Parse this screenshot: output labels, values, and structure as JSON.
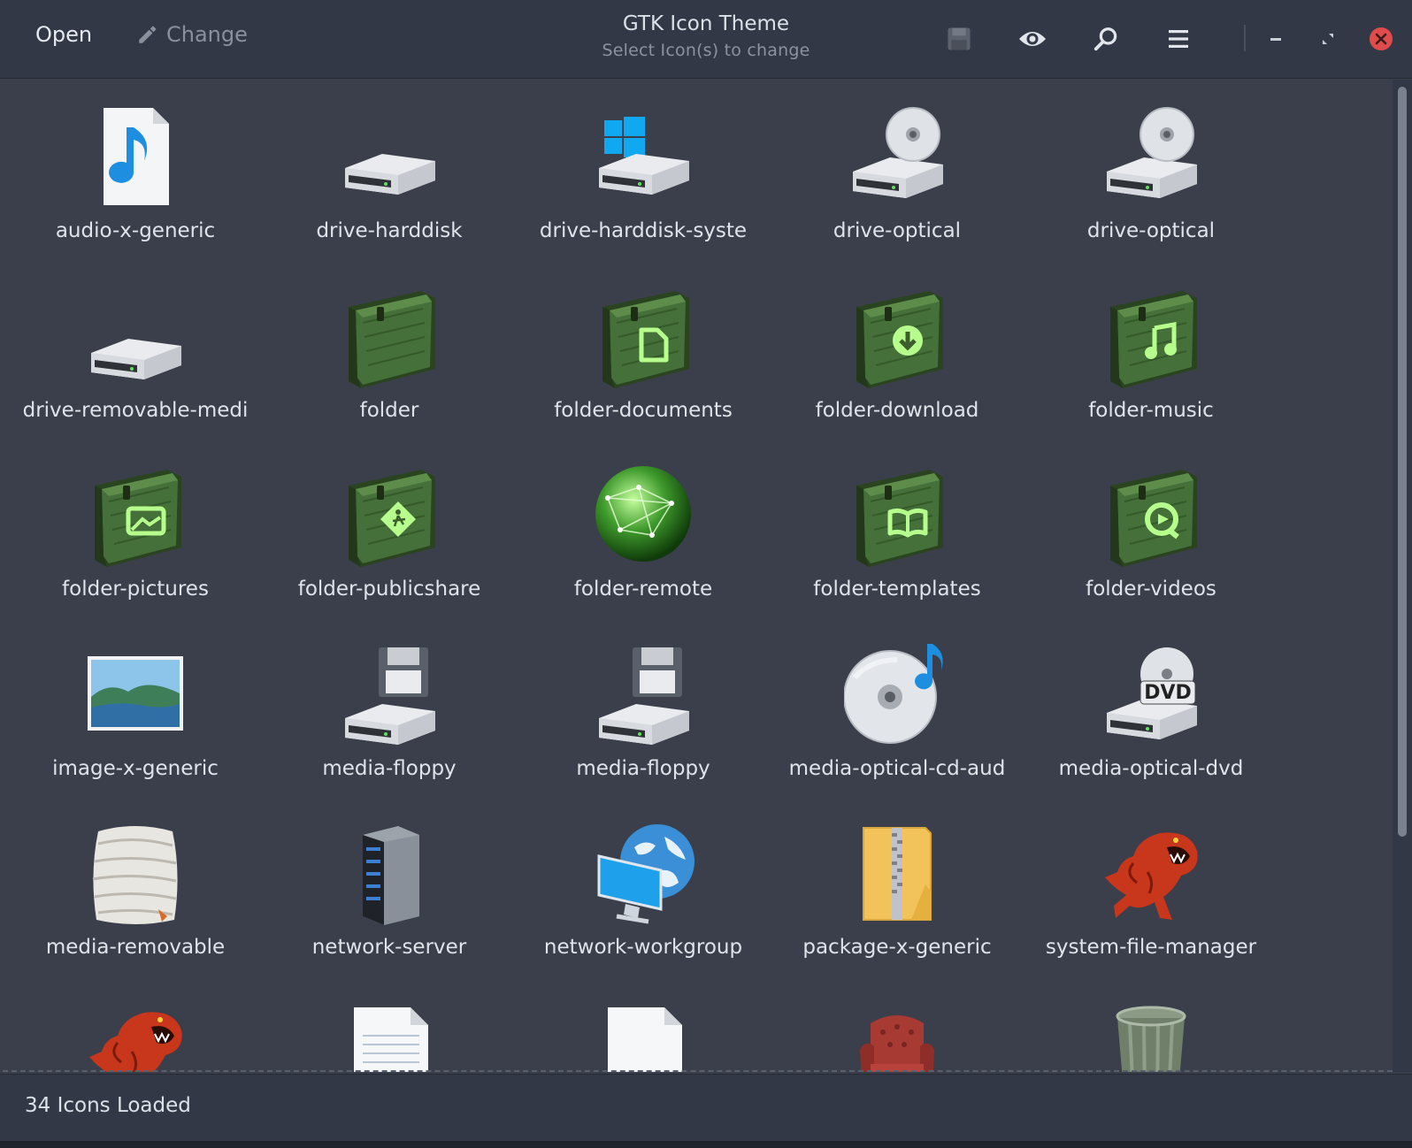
{
  "header": {
    "open_label": "Open",
    "change_label": "Change",
    "title": "GTK Icon Theme",
    "subtitle": "Select Icon(s) to change",
    "toolbar_icons": [
      "save-icon",
      "eye-icon",
      "search-icon",
      "menu-icon",
      "minimize-icon",
      "restore-icon",
      "close-icon"
    ]
  },
  "icons": [
    {
      "label": "audio-x-generic",
      "icon": "audio-file"
    },
    {
      "label": "drive-harddisk",
      "icon": "harddisk"
    },
    {
      "label": "drive-harddisk-syste",
      "icon": "harddisk-system"
    },
    {
      "label": "drive-optical",
      "icon": "optical-drive"
    },
    {
      "label": "drive-optical",
      "icon": "optical-drive"
    },
    {
      "label": "drive-removable-medi",
      "icon": "harddisk-small"
    },
    {
      "label": "folder",
      "icon": "folder"
    },
    {
      "label": "folder-documents",
      "icon": "folder-documents"
    },
    {
      "label": "folder-download",
      "icon": "folder-download"
    },
    {
      "label": "folder-music",
      "icon": "folder-music"
    },
    {
      "label": "folder-pictures",
      "icon": "folder-pictures"
    },
    {
      "label": "folder-publicshare",
      "icon": "folder-publicshare"
    },
    {
      "label": "folder-remote",
      "icon": "globe-green"
    },
    {
      "label": "folder-templates",
      "icon": "folder-templates"
    },
    {
      "label": "folder-videos",
      "icon": "folder-videos"
    },
    {
      "label": "image-x-generic",
      "icon": "landscape-image"
    },
    {
      "label": "media-floppy",
      "icon": "floppy-drive"
    },
    {
      "label": "media-floppy",
      "icon": "floppy-drive"
    },
    {
      "label": "media-optical-cd-aud",
      "icon": "cd-audio"
    },
    {
      "label": "media-optical-dvd",
      "icon": "dvd-drive"
    },
    {
      "label": "media-removable",
      "icon": "mummy"
    },
    {
      "label": "network-server",
      "icon": "server-tower"
    },
    {
      "label": "network-workgroup",
      "icon": "globe-monitor"
    },
    {
      "label": "package-x-generic",
      "icon": "zip-folder"
    },
    {
      "label": "system-file-manager",
      "icon": "red-creature"
    },
    {
      "label": "",
      "icon": "red-creature"
    },
    {
      "label": "",
      "icon": "text-document"
    },
    {
      "label": "",
      "icon": "blank-document"
    },
    {
      "label": "",
      "icon": "red-armchair"
    },
    {
      "label": "",
      "icon": "trash-can"
    }
  ],
  "status": {
    "text": "34 Icons Loaded"
  },
  "colors": {
    "background": "#3a3f4b",
    "header": "#323845",
    "folder_green": "#3d5e2c",
    "glow_green": "#a6f07a",
    "accent_blue": "#1e8fe0",
    "close_red": "#e04b4b"
  }
}
